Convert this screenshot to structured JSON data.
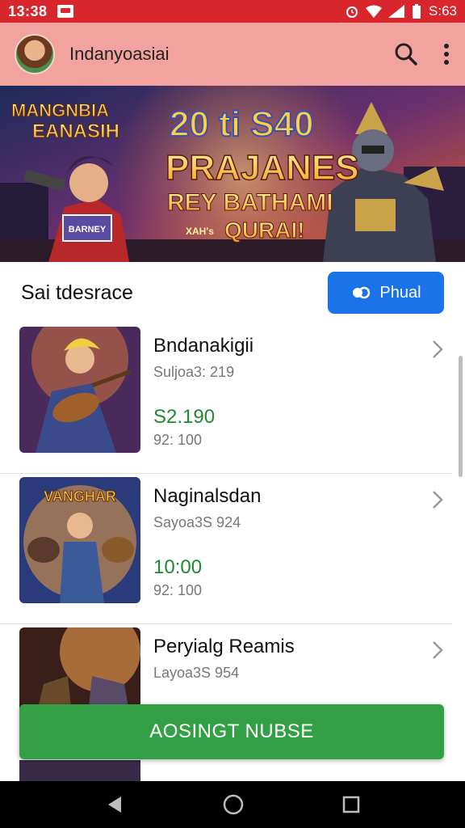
{
  "status_bar": {
    "time": "13:38",
    "battery_text": "S:63"
  },
  "app_bar": {
    "title": "Indanyoasiai",
    "avatar_icon": "user-avatar",
    "search_icon": "search-icon",
    "more_icon": "more-vert-icon"
  },
  "banner": {
    "top_left_line1": "MANGNBIA",
    "top_left_line2": "EANASIH",
    "headline_1": "20 ti S40",
    "headline_2": "PRAJANES",
    "headline_3": "REY BATHAMI",
    "headline_4": "QURAI!",
    "small_tag": "XAH's",
    "sign_text": "BARNEY"
  },
  "section": {
    "title": "Sai tdesrace",
    "button_label": "Phual",
    "button_icon": "sync-icon"
  },
  "items": [
    {
      "title": "Bndanakigii",
      "subtitle": "Suljoa3: 219",
      "price": "S2.190",
      "meta": "92: 100"
    },
    {
      "title": "Naginalsdan",
      "subtitle": "Sayoa3S 924",
      "price": "10:00",
      "meta": "92: 100"
    },
    {
      "title": "Peryialg Reamis",
      "subtitle": "Layoa3S 954",
      "price": "",
      "meta": ""
    }
  ],
  "thumb2_label": "VANGHAR",
  "cta": {
    "label": "AOSINGT NUBSE"
  },
  "nav": {
    "back_icon": "back-icon",
    "home_icon": "home-icon",
    "recents_icon": "recents-icon"
  },
  "colors": {
    "status": "#d8262c",
    "app_bar": "#f2a39f",
    "primary": "#1a73e8",
    "price": "#1e8a2e",
    "cta": "#34a046"
  }
}
